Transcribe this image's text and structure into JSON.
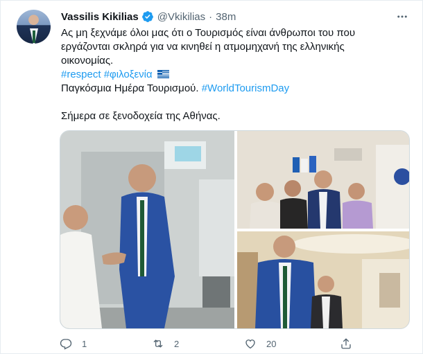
{
  "author": {
    "name": "Vassilis Kikilias",
    "handle": "@Vkikilias",
    "separator": "·",
    "time": "38m"
  },
  "tweet": {
    "line1": "Ας μη ξεχνάμε όλοι μας ότι ο Τουρισμός είναι άνθρωποι του που",
    "line2": "εργάζονται σκληρά για να κινηθεί η ατμομηχανή της ελληνικής",
    "line3": "οικονομίας.",
    "hashtag1": "#respect",
    "hashtag2": "#φιλοξενία",
    "line5_text": "Παγκόσμια Ημέρα Τουρισμού.",
    "hashtag3": "#WorldTourismDay",
    "line7": "Σήμερα σε ξενοδοχεία της Αθήνας."
  },
  "actions": {
    "reply_count": "1",
    "retweet_count": "2",
    "like_count": "20"
  },
  "colors": {
    "link": "#1d9bf0",
    "secondary_text": "#536471",
    "verified": "#1d9bf0"
  },
  "icons": [
    "verified-badge-icon",
    "more-options-icon",
    "reply-icon",
    "retweet-icon",
    "like-icon",
    "share-icon",
    "greek-flag-icon"
  ]
}
